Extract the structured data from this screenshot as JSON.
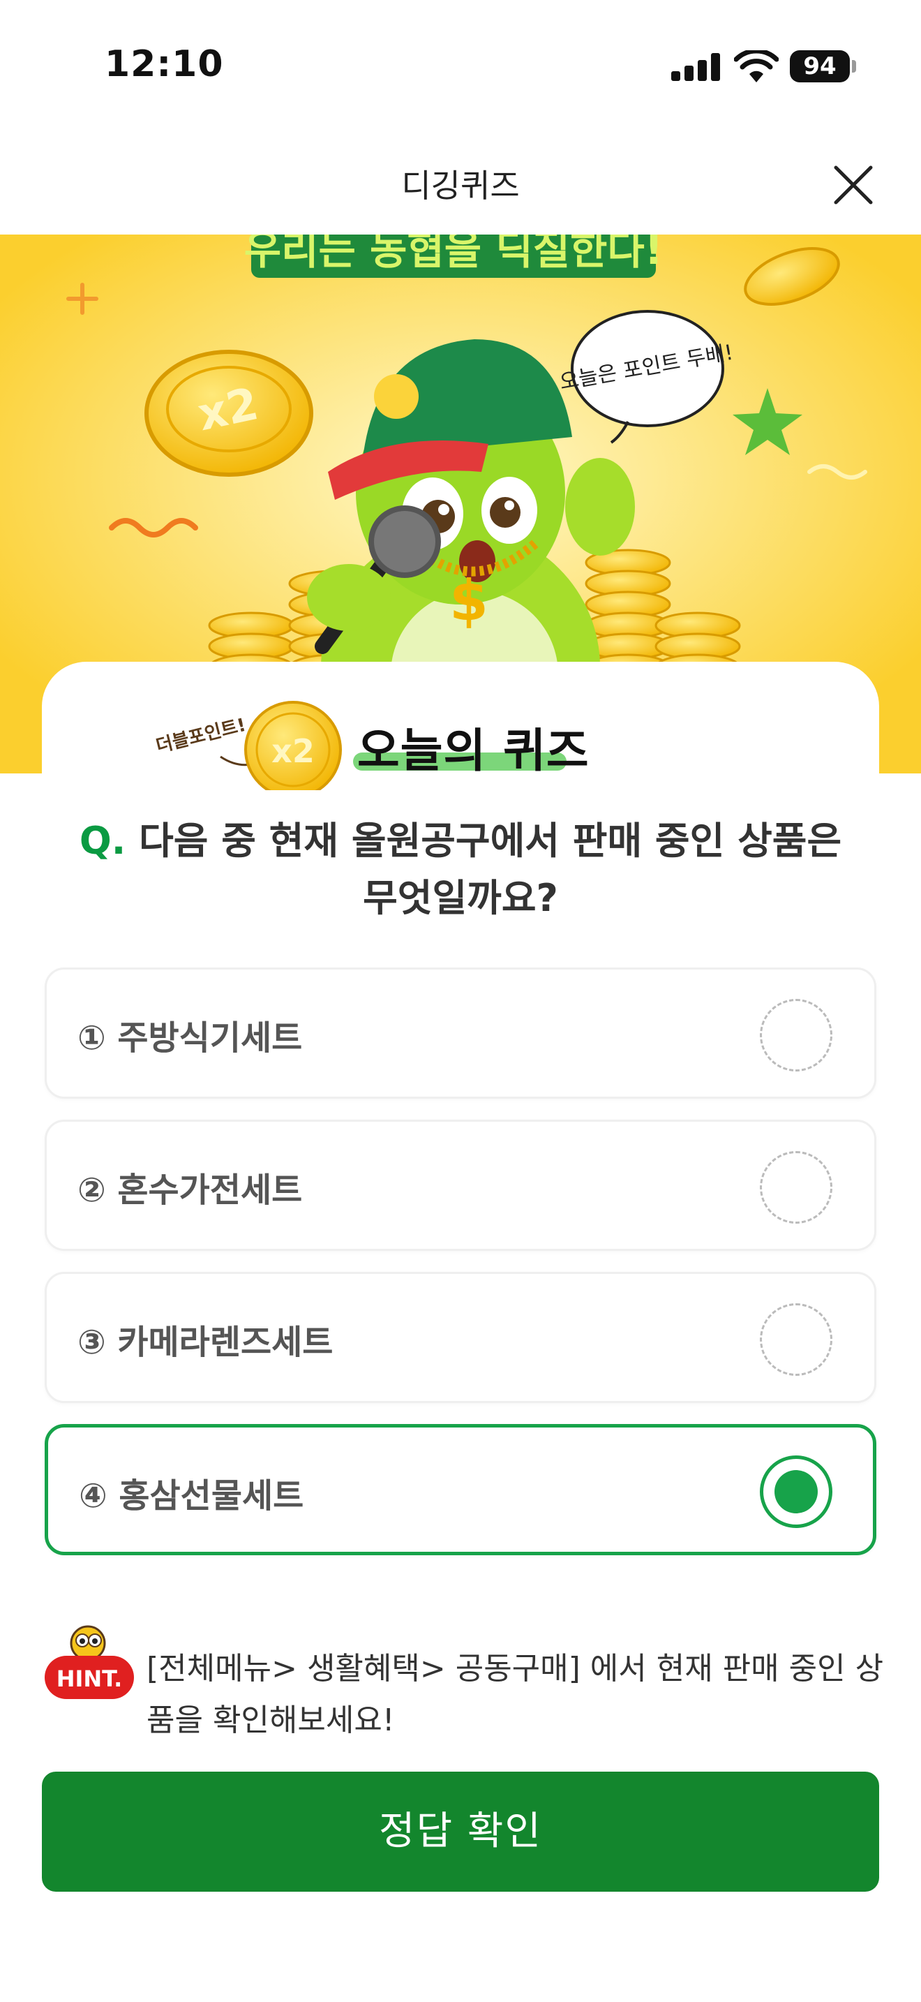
{
  "status_bar": {
    "time": "12:10",
    "battery": "94"
  },
  "header": {
    "title": "디깅퀴즈",
    "close_icon": "close-icon"
  },
  "banner": {
    "headline": "우리는 농협을 딕질한다!",
    "speech_bubble": "오늘은 포인트 두배!",
    "coin_label": "x2",
    "colors": {
      "background": "#fbd33a",
      "mascot": "#9ad926",
      "cap": "#1d8a4a"
    }
  },
  "quiz_badge": {
    "tag": "더블포인트!",
    "coin_label": "x2",
    "heading": "오늘의 퀴즈"
  },
  "question": {
    "prefix": "Q.",
    "text": "다음 중 현재 올원공구에서 판매 중인 상품은 무엇일까요?"
  },
  "options": [
    {
      "label": "① 주방식기세트",
      "selected": false
    },
    {
      "label": "② 혼수가전세트",
      "selected": false
    },
    {
      "label": "③ 카메라렌즈세트",
      "selected": false
    },
    {
      "label": "④ 홍삼선물세트",
      "selected": true
    }
  ],
  "hint": {
    "badge": "HINT.",
    "text": "[전체메뉴> 생활혜택> 공동구매] 에서 현재 판매 중인 상품을 확인해보세요!"
  },
  "submit": {
    "label": "정답 확인"
  },
  "colors": {
    "accent": "#17a34a",
    "button": "#13862d",
    "hint_badge": "#e02020"
  }
}
